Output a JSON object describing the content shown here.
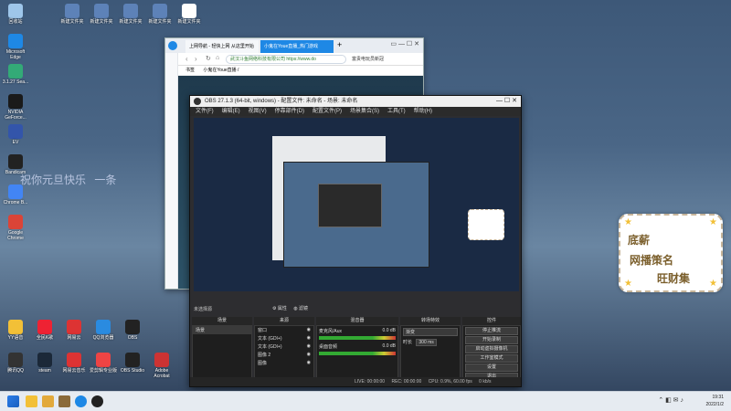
{
  "desktop": {
    "icons_left": [
      {
        "label": "回收站"
      },
      {
        "label": "Microsoft Edge"
      },
      {
        "label": "3.1.27 Sea..."
      },
      {
        "label": "NVIDIA GeForce..."
      },
      {
        "label": "EV"
      },
      {
        "label": "Bandicam"
      },
      {
        "label": "Chrome B..."
      },
      {
        "label": "Google Chrome"
      }
    ],
    "icons_top": [
      {
        "label": "新建文件夹"
      },
      {
        "label": "新建文件夹"
      },
      {
        "label": "新建文件夹"
      },
      {
        "label": "新建文件夹"
      },
      {
        "label": "新建文件夹"
      }
    ],
    "icons_bottom_row1": [
      {
        "label": "YY语音"
      },
      {
        "label": "全民K歌"
      },
      {
        "label": "网易云"
      },
      {
        "label": "QQ浏览器"
      },
      {
        "label": "OBS"
      }
    ],
    "icons_bottom_row2": [
      {
        "label": "腾讯QQ"
      },
      {
        "label": "steam"
      },
      {
        "label": "网易云音乐"
      },
      {
        "label": "爱剪辑专业版"
      },
      {
        "label": "OBS Studio"
      },
      {
        "label": "Adobe Acrobat"
      }
    ],
    "overlay_text": [
      "祝你元旦快乐",
      "一条"
    ]
  },
  "browser": {
    "tabs": [
      {
        "label": "上网导航 - 轻快上网 从这里开始"
      },
      {
        "label": "小鬼在Youe直播_热门游戏"
      }
    ],
    "address": "武汉斗鱼网络科技有限公司   https://www.do",
    "address_right": "富贵电玩员新冠",
    "bookmarks": [
      "书签",
      "小鬼在Youe直播 / "
    ],
    "colors": {
      "accent": "#1e88e5"
    }
  },
  "obs": {
    "title": "OBS 27.1.3 (64-bit, windows) - 配置文件: 未命名 - 场景: 未命名",
    "menu": [
      "文件(F)",
      "编辑(E)",
      "视图(V)",
      "停靠部件(D)",
      "配置文件(P)",
      "场景集合(S)",
      "工具(T)",
      "帮助(H)"
    ],
    "preview_label": "未选择源",
    "toolbar": {
      "props": "属性",
      "filters": "滤镜"
    },
    "docks": {
      "scenes": {
        "title": "场景",
        "items": [
          "场景"
        ]
      },
      "sources": {
        "title": "来源",
        "items": [
          "窗口",
          "文本 (GDI+)",
          "文本 (GDI+)",
          "图像 2",
          "图像"
        ]
      },
      "mixer": {
        "title": "混音器",
        "channels": [
          {
            "name": "麦克风/Aux",
            "db": "0.0 dB"
          },
          {
            "name": "桌面音频",
            "db": "0.0 dB"
          }
        ]
      },
      "transitions": {
        "title": "转场特效",
        "type": "渐变",
        "duration_label": "时长",
        "duration": "300 ms"
      },
      "controls": {
        "title": "控件",
        "buttons": [
          "停止推流",
          "开始录制",
          "启动虚拟摄像机",
          "工作室模式",
          "设置",
          "退出"
        ]
      }
    },
    "status": {
      "live": "LIVE: 00:00:00",
      "rec": "REC: 00:00:00",
      "cpu": "CPU: 0.9%, 60.00 fps",
      "kb": "0 kb/s"
    }
  },
  "sticker": {
    "line1": "底薪",
    "line2": "网播策名",
    "line3": "旺财集"
  },
  "taskbar": {
    "time": "19:31",
    "date": "2022/1/2"
  }
}
